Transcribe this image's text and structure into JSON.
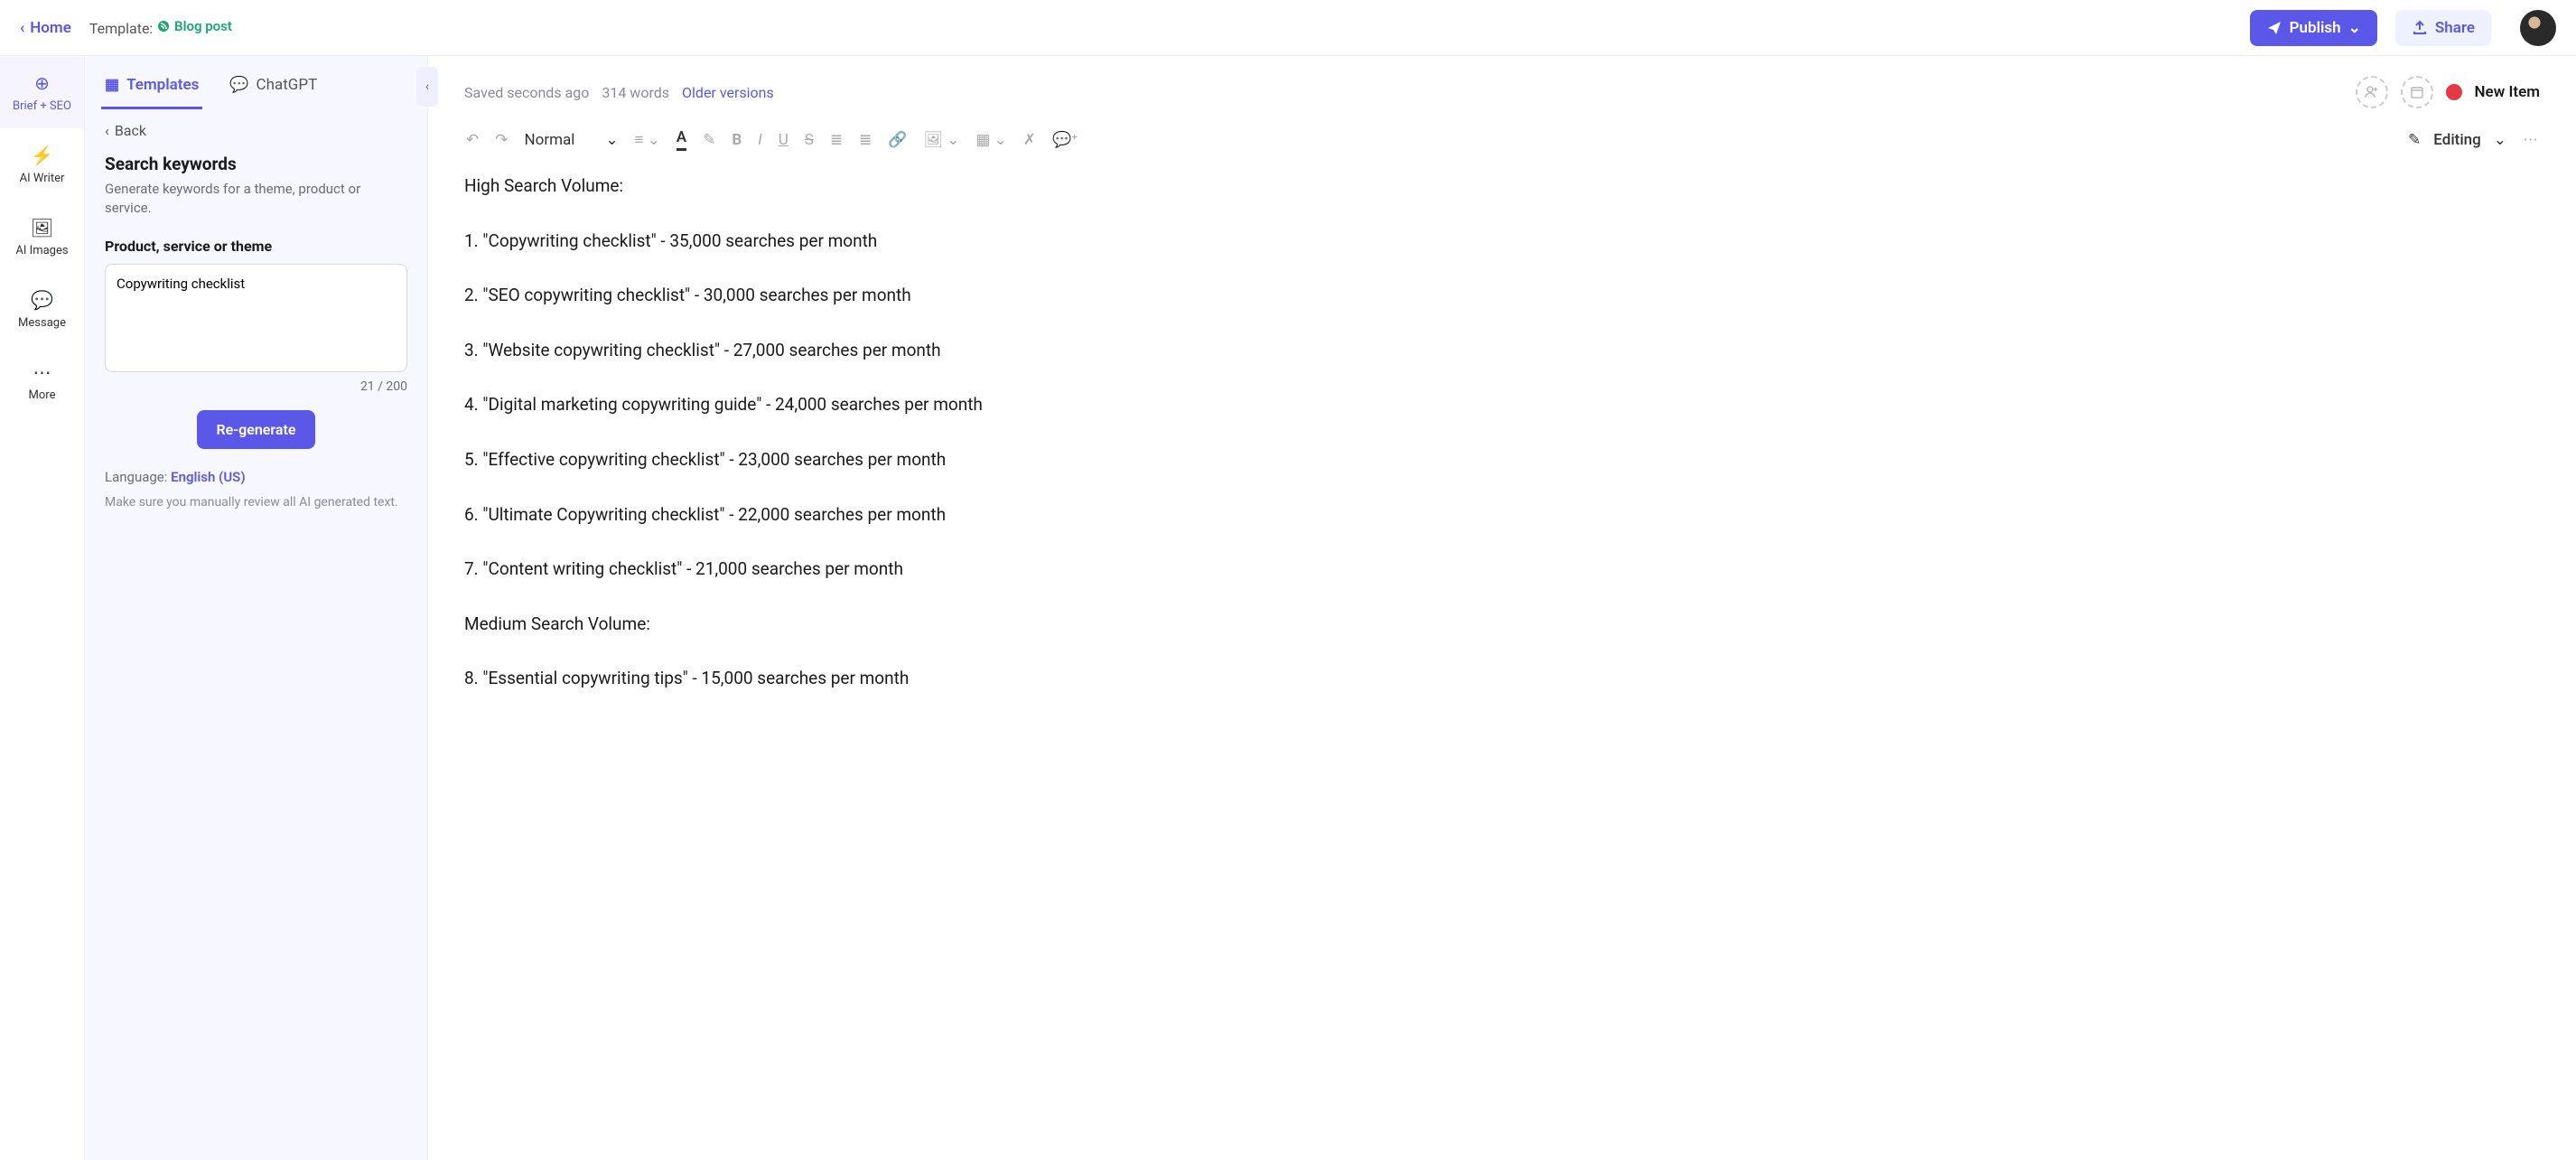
{
  "header": {
    "home": "Home",
    "template_label": "Template:",
    "template_name": "Blog post",
    "publish": "Publish",
    "share": "Share"
  },
  "leftbar": {
    "items": [
      {
        "label": "Brief + SEO"
      },
      {
        "label": "AI Writer"
      },
      {
        "label": "AI Images"
      },
      {
        "label": "Message"
      },
      {
        "label": "More"
      }
    ]
  },
  "panel": {
    "tabs": {
      "templates": "Templates",
      "chatgpt": "ChatGPT"
    },
    "back": "Back",
    "title": "Search keywords",
    "desc": "Generate keywords for a theme, product or service.",
    "field_label": "Product, service or theme",
    "textarea_value": "Copywriting checklist",
    "char_count": "21 / 200",
    "regenerate": "Re-generate",
    "language_label": "Language:",
    "language": "English (US)",
    "disclaimer": "Make sure you manually review all AI generated text."
  },
  "editor_top": {
    "saved": "Saved seconds ago",
    "words": "314 words",
    "older": "Older versions",
    "new_item": "New Item"
  },
  "toolbar": {
    "style": "Normal",
    "editing": "Editing"
  },
  "doc": {
    "h1": "High Search Volume:",
    "l1": "1. \"Copywriting checklist\" - 35,000 searches per month",
    "l2": "2. \"SEO copywriting checklist\" - 30,000 searches per month",
    "l3": "3. \"Website copywriting checklist\" - 27,000 searches per month",
    "l4": "4. \"Digital marketing copywriting guide\" - 24,000 searches per month",
    "l5": "5. \"Effective copywriting checklist\" - 23,000 searches per month",
    "l6": "6. \"Ultimate Copywriting checklist\" - 22,000 searches per month",
    "l7": "7. \"Content writing checklist\" - 21,000 searches per month",
    "h2": "Medium Search Volume:",
    "l8": "8. \"Essential copywriting tips\" - 15,000 searches per month"
  }
}
